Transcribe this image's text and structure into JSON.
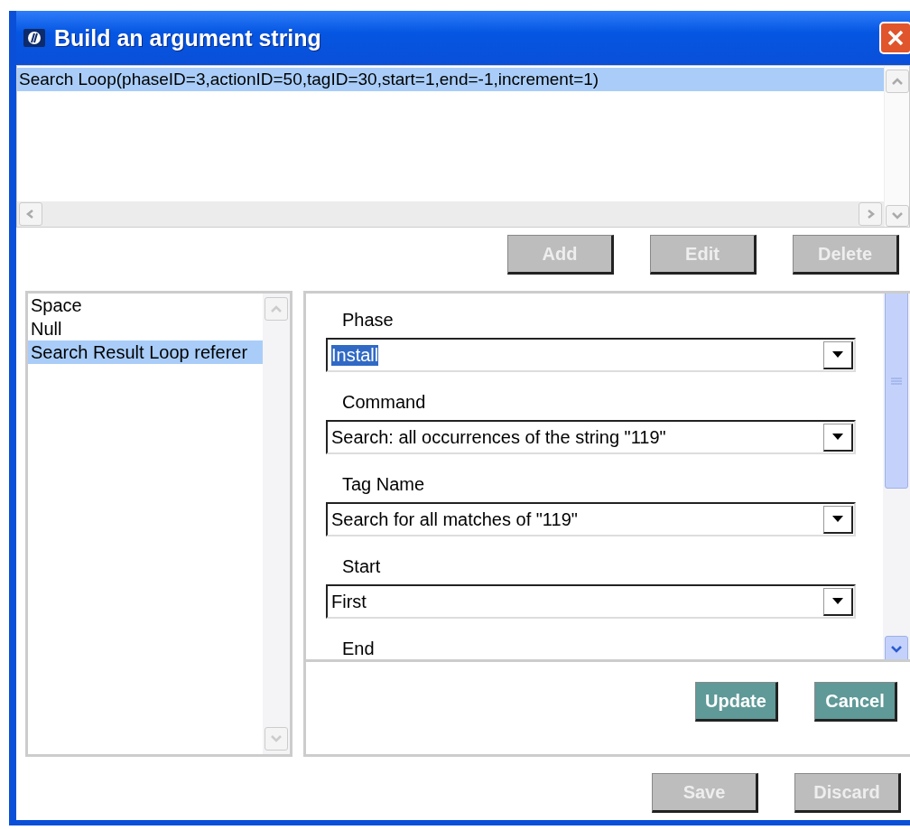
{
  "window": {
    "title": "Build an argument string"
  },
  "arguments": [
    {
      "text": "Search Loop(phaseID=3,actionID=50,tagID=30,start=1,end=-1,increment=1)",
      "selected": true
    }
  ],
  "argument_buttons": [
    {
      "label": "Add",
      "disabled": true
    },
    {
      "label": "Edit",
      "disabled": true
    },
    {
      "label": "Delete",
      "disabled": true
    }
  ],
  "types": [
    {
      "label": "Space",
      "selected": false
    },
    {
      "label": "Null",
      "selected": false
    },
    {
      "label": "Search Result Loop referer",
      "selected": true
    }
  ],
  "form": {
    "fields": [
      {
        "label": "Phase",
        "value": "Install",
        "value_selected": true
      },
      {
        "label": "Command",
        "value": "Search: all occurrences of the string \"119\"",
        "value_selected": false
      },
      {
        "label": "Tag Name",
        "value": "Search for all matches of \"119\"",
        "value_selected": false
      },
      {
        "label": "Start",
        "value": "First",
        "value_selected": false
      },
      {
        "label": "End"
      }
    ]
  },
  "form_buttons": [
    {
      "label": "Update",
      "disabled": false
    },
    {
      "label": "Cancel",
      "disabled": false
    }
  ],
  "buttons": [
    {
      "label": "Save",
      "disabled": true
    },
    {
      "label": "Discard",
      "disabled": true
    }
  ]
}
